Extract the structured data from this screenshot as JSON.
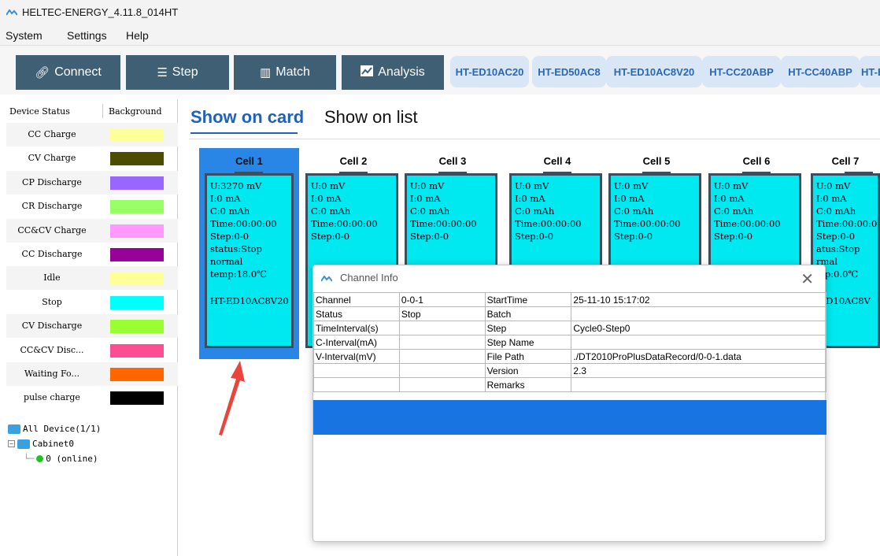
{
  "window": {
    "title": "HELTEC-ENERGY_4.11.8_014HT"
  },
  "menu": [
    "System",
    "Settings",
    "Help"
  ],
  "toolbar": {
    "buttons": [
      {
        "label": "Connect",
        "icon": "link-icon"
      },
      {
        "label": "Step",
        "icon": "list-icon"
      },
      {
        "label": "Match",
        "icon": "match-icon"
      },
      {
        "label": "Analysis",
        "icon": "chart-icon"
      }
    ],
    "device_tabs": [
      "HT-ED10AC20",
      "HT-ED50AC8",
      "HT-ED10AC8V20",
      "HT-CC20ABP",
      "HT-CC40ABP",
      "HT-B"
    ]
  },
  "sidebar": {
    "header_status": "Device Status",
    "header_background": "Background",
    "statuses": [
      {
        "label": "CC Charge",
        "color": "#ffff99"
      },
      {
        "label": "CV Charge",
        "color": "#4d4d00"
      },
      {
        "label": "CP Discharge",
        "color": "#9966ff"
      },
      {
        "label": "CR Discharge",
        "color": "#99ff66"
      },
      {
        "label": "CC&CV Charge",
        "color": "#ff99ff"
      },
      {
        "label": "CC Discharge",
        "color": "#990099"
      },
      {
        "label": "Idle",
        "color": "#ffff99"
      },
      {
        "label": "Stop",
        "color": "#00ffff"
      },
      {
        "label": "CV Discharge",
        "color": "#99ff33"
      },
      {
        "label": "CC&CV Disc...",
        "color": "#ff4d94"
      },
      {
        "label": "Waiting Fo...",
        "color": "#ff6600"
      },
      {
        "label": "pulse charge",
        "color": "#000000"
      }
    ],
    "tree": {
      "root": "All Device(1/1)",
      "cabinet": "Cabinet0",
      "device": "0 (online)"
    }
  },
  "view_tabs": {
    "card": "Show on card",
    "list": "Show on list"
  },
  "cells": [
    {
      "name": "Cell 1",
      "u": "U:3270 mV",
      "i": "I:0 mA",
      "c": "C:0 mAh",
      "time": "Time:00:00:00",
      "step": "Step:0-0",
      "status": "status:Stop",
      "state": "normal",
      "temp": "temp:18.0℃",
      "model": "HT-ED10AC8V20"
    },
    {
      "name": "Cell 2",
      "u": "U:0 mV",
      "i": "I:0 mA",
      "c": "C:0 mAh",
      "time": "Time:00:00:00",
      "step": "Step:0-0"
    },
    {
      "name": "Cell 3",
      "u": "U:0 mV",
      "i": "I:0 mA",
      "c": "C:0 mAh",
      "time": "Time:00:00:00",
      "step": "Step:0-0"
    },
    {
      "name": "Cell 4",
      "u": "U:0 mV",
      "i": "I:0 mA",
      "c": "C:0 mAh",
      "time": "Time:00:00:00",
      "step": "Step:0-0"
    },
    {
      "name": "Cell 5",
      "u": "U:0 mV",
      "i": "I:0 mA",
      "c": "C:0 mAh",
      "time": "Time:00:00:00",
      "step": "Step:0-0"
    },
    {
      "name": "Cell 6",
      "u": "U:0 mV",
      "i": "I:0 mA",
      "c": "C:0 mAh",
      "time": "Time:00:00:00",
      "step": "Step:0-0"
    },
    {
      "name": "Cell 7",
      "u": "U:0 mV",
      "i": "I:0 mA",
      "c": "C:0 mAh",
      "time": "Time:00:00:0",
      "step": "Step:0-0",
      "status": "atus:Stop",
      "state": "rmal",
      "temp": "mp:0.0℃",
      "model": "-ED10AC8V"
    }
  ],
  "dialog": {
    "title": "Channel Info",
    "rows": [
      [
        "Channel",
        "0-0-1",
        "StartTime",
        "25-11-10 15:17:02"
      ],
      [
        "Status",
        "Stop",
        "Batch",
        ""
      ],
      [
        "TimeInterval(s)",
        "",
        "Step",
        "Cycle0-Step0"
      ],
      [
        "C-Interval(mA)",
        "",
        "Step Name",
        ""
      ],
      [
        "V-Interval(mV)",
        "",
        "File Path",
        "./DT2010ProPlusDataRecord/0-0-1.data"
      ],
      [
        "",
        "",
        "Version",
        "2.3"
      ],
      [
        "",
        "",
        "Remarks",
        ""
      ]
    ]
  },
  "colors": {
    "toolbar_button": "#3f5f75",
    "accent": "#1e63b5",
    "cell_fill": "#00e8f0",
    "selection": "#2a86e6",
    "arrow": "#e8453c"
  }
}
